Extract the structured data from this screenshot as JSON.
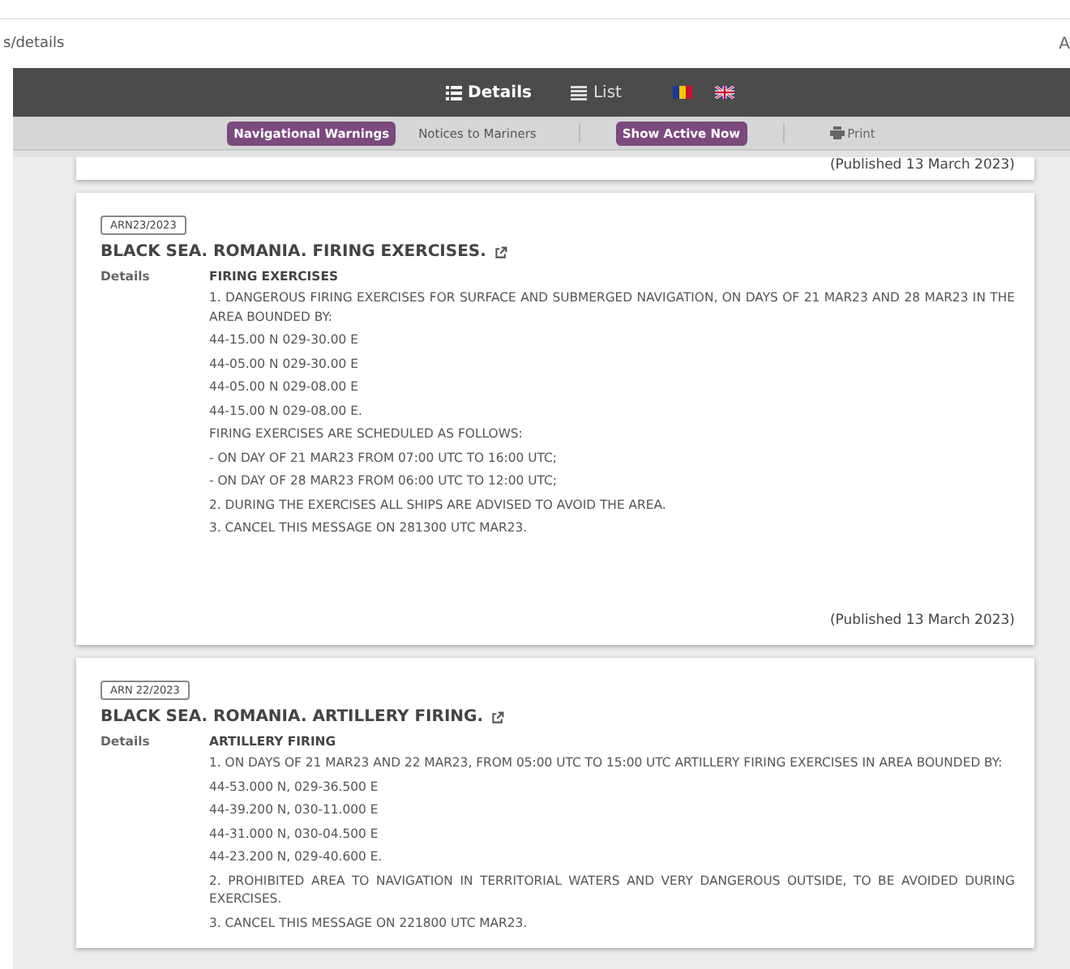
{
  "address_bar": {
    "url": "s/details",
    "reader_icon_text": "A"
  },
  "view_tabs": [
    {
      "label": "Details",
      "selected": true,
      "kind": "details"
    },
    {
      "label": "List",
      "selected": false,
      "kind": "list"
    }
  ],
  "languages": [
    {
      "kind": "ro",
      "selected": false
    },
    {
      "kind": "uk",
      "selected": false
    }
  ],
  "filters": [
    {
      "label": "Navigational Warnings",
      "selected": true
    },
    {
      "label": "Notices to Mariners",
      "selected": false
    }
  ],
  "show_active_button": "Show Active Now",
  "print_button": "Print",
  "previous_card": {
    "published": "(Published 13 March 2023)"
  },
  "warnings": [
    {
      "id": "ARN23/2023",
      "title": "BLACK SEA. ROMANIA. FIRING EXERCISES.",
      "details_label": "Details",
      "heading": "FIRING EXERCISES",
      "lines": [
        "1. DANGEROUS FIRING EXERCISES FOR SURFACE AND SUBMERGED NAVIGATION, ON DAYS OF 21 MAR23 AND 28 MAR23 IN THE AREA BOUNDED BY:",
        "44-15.00 N  029-30.00 E",
        "44-05.00 N  029-30.00 E",
        "44-05.00 N  029-08.00 E",
        "44-15.00 N  029-08.00 E.",
        "FIRING EXERCISES ARE SCHEDULED AS FOLLOWS:",
        "-  ON DAY  OF 21 MAR23  FROM 07:00 UTC TO 16:00 UTC;",
        "-  ON DAY  OF 28 MAR23  FROM 06:00 UTC TO 12:00 UTC;",
        "2. DURING THE EXERCISES ALL SHIPS ARE ADVISED TO AVOID THE AREA.",
        "3. CANCEL THIS MESSAGE ON 281300 UTC MAR23."
      ],
      "published": "(Published 13 March 2023)"
    },
    {
      "id": "ARN 22/2023",
      "title": "BLACK SEA. ROMANIA. ARTILLERY FIRING.",
      "details_label": "Details",
      "heading": "ARTILLERY FIRING",
      "lines": [
        "1. ON DAYS OF 21 MAR23 AND 22 MAR23, FROM 05:00  UTC TO 15:00 UTC ARTILLERY FIRING EXERCISES IN AREA BOUNDED BY:",
        "44-53.000 N, 029-36.500 E",
        "44-39.200 N, 030-11.000 E",
        "44-31.000 N, 030-04.500 E",
        "44-23.200 N, 029-40.600 E.",
        "2. PROHIBITED AREA TO NAVIGATION IN TERRITORIAL WATERS AND VERY  DANGEROUS OUTSIDE, TO BE  AVOIDED DURING EXERCISES.",
        "3. CANCEL THIS MESSAGE ON 221800 UTC MAR23."
      ]
    }
  ]
}
